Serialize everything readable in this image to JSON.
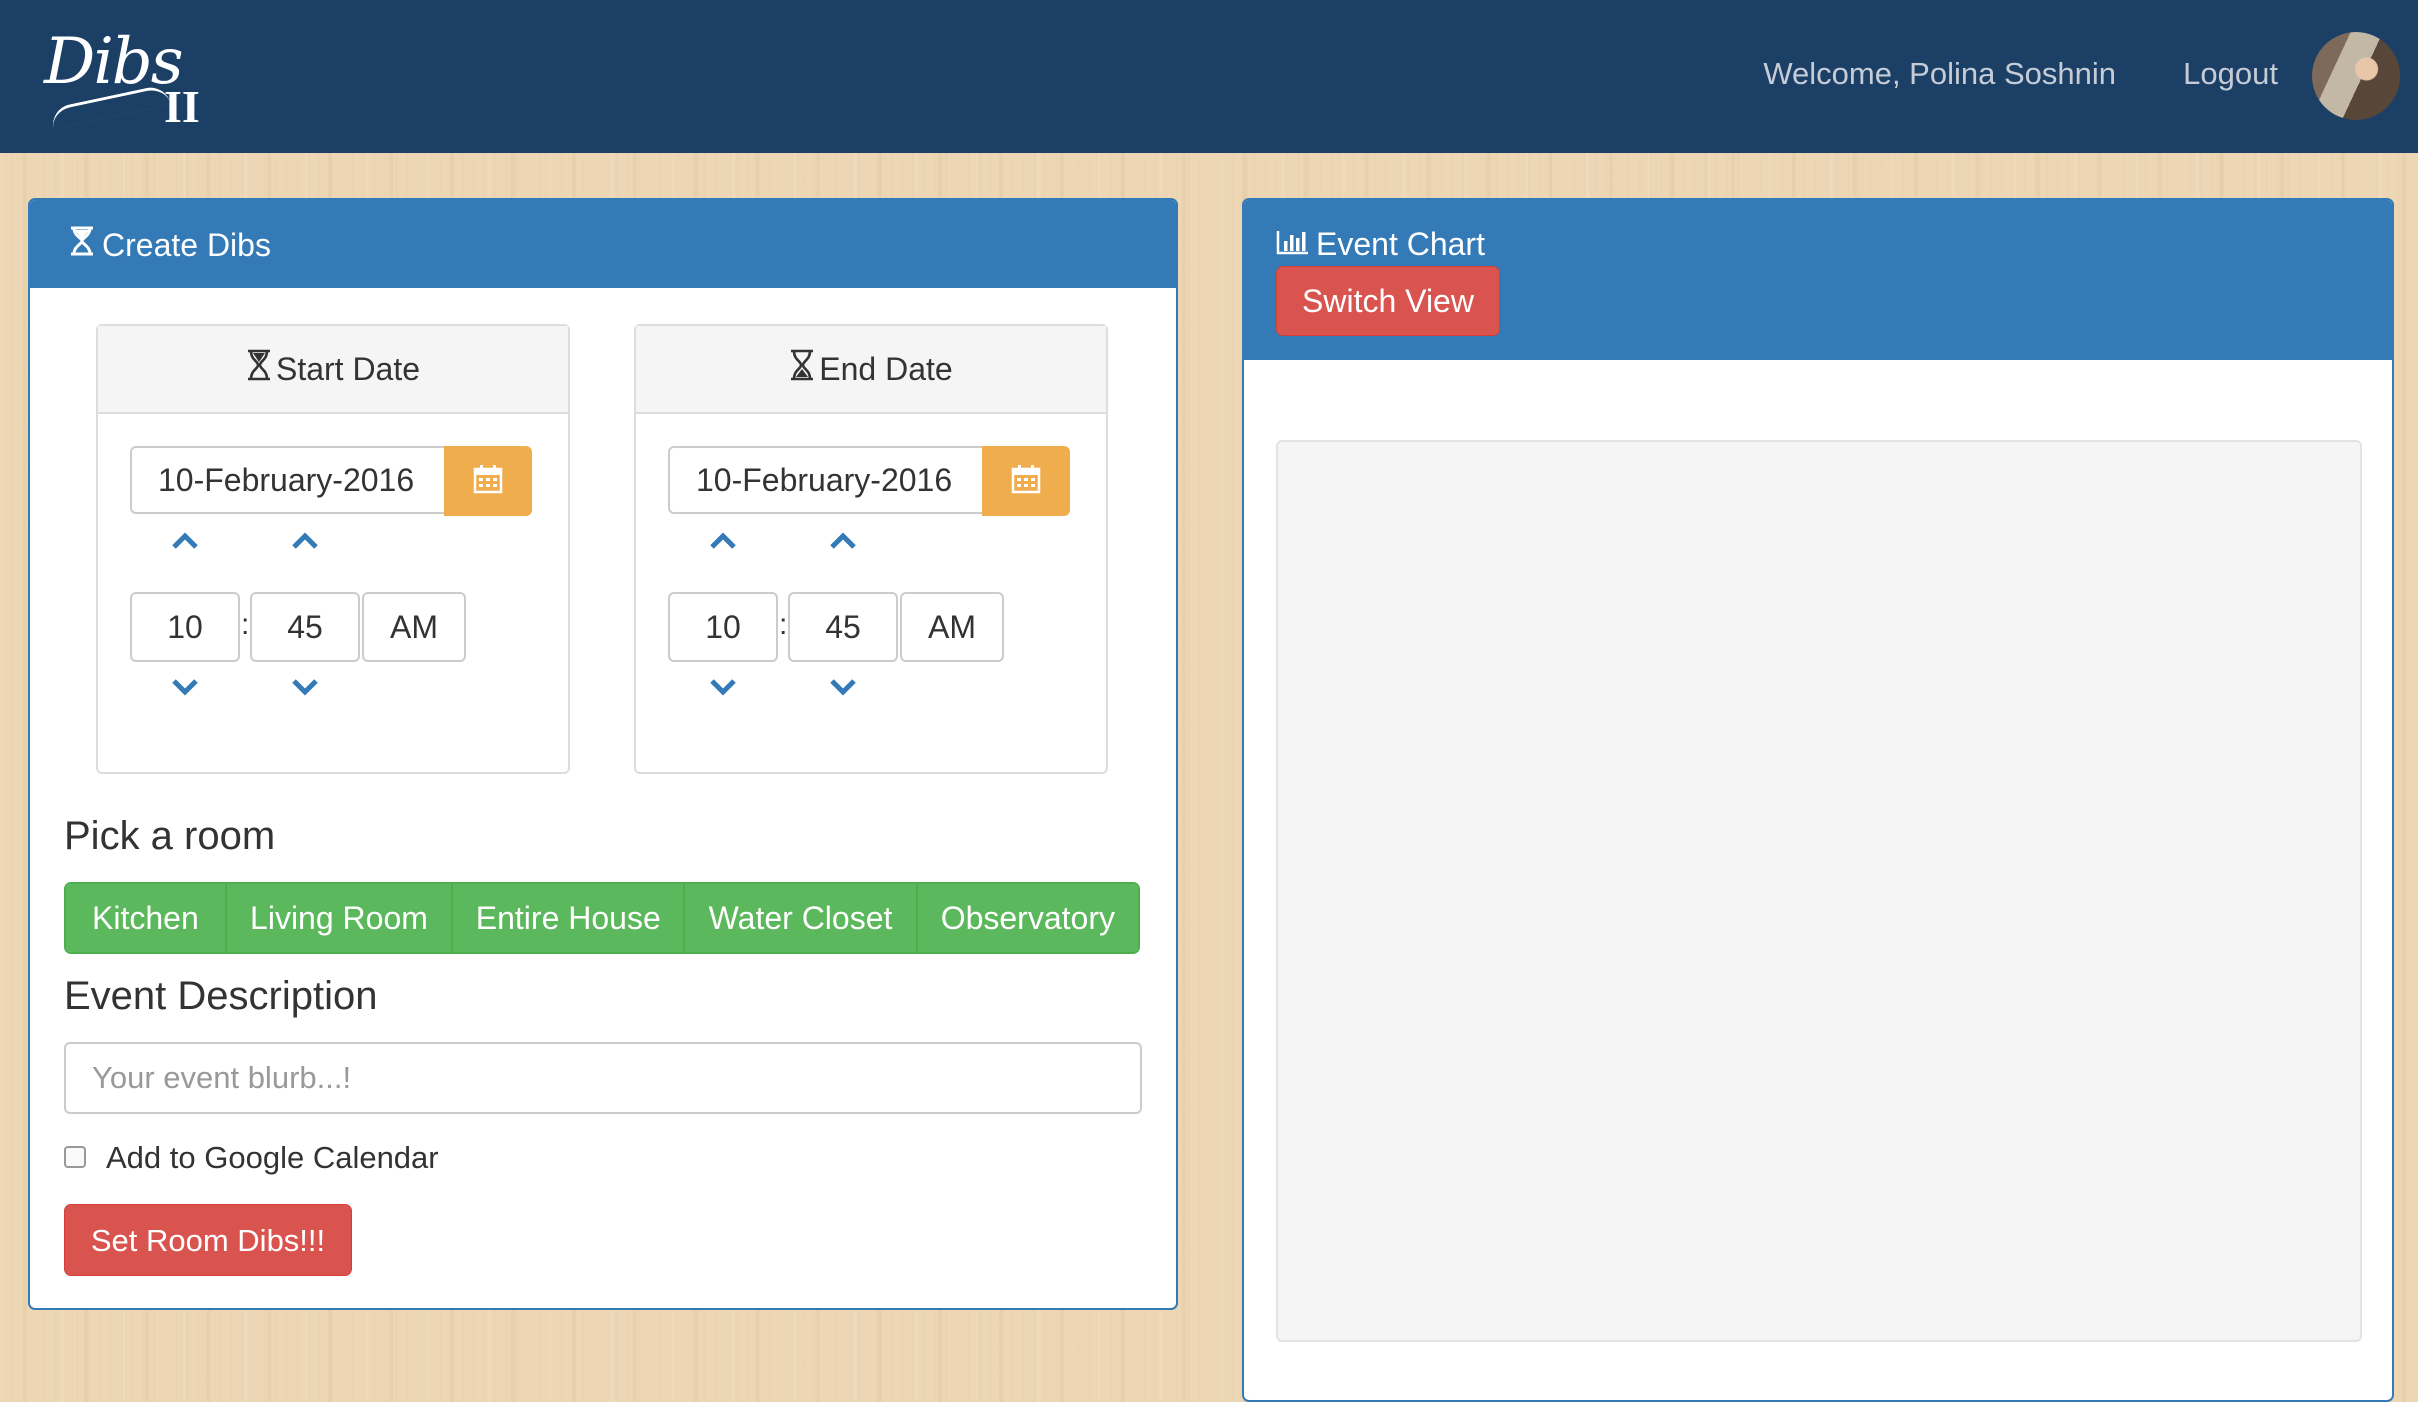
{
  "navbar": {
    "logo_script": "Dibs",
    "logo_numeral": "II",
    "welcome_text": "Welcome, Polina Soshnin",
    "logout_label": "Logout"
  },
  "create_panel": {
    "title": "Create Dibs",
    "start": {
      "heading": "Start Date",
      "date": "10-February-2016",
      "hour": "10",
      "minute": "45",
      "meridian": "AM"
    },
    "end": {
      "heading": "End Date",
      "date": "10-February-2016",
      "hour": "10",
      "minute": "45",
      "meridian": "AM"
    },
    "time_separator": ":",
    "room_label": "Pick a room",
    "rooms": [
      "Kitchen",
      "Living Room",
      "Entire House",
      "Water Closet",
      "Observatory"
    ],
    "description_label": "Event Description",
    "description_placeholder": "Your event blurb...!",
    "gcal_label": "Add to Google Calendar",
    "gcal_checked": false,
    "submit_label": "Set Room Dibs!!!"
  },
  "chart_panel": {
    "title": "Event Chart",
    "switch_label": "Switch View"
  },
  "colors": {
    "navbar": "#1c3f66",
    "primary": "#337ab7",
    "danger": "#d9534f",
    "success": "#5cb85c",
    "warning": "#f0ad4e"
  }
}
